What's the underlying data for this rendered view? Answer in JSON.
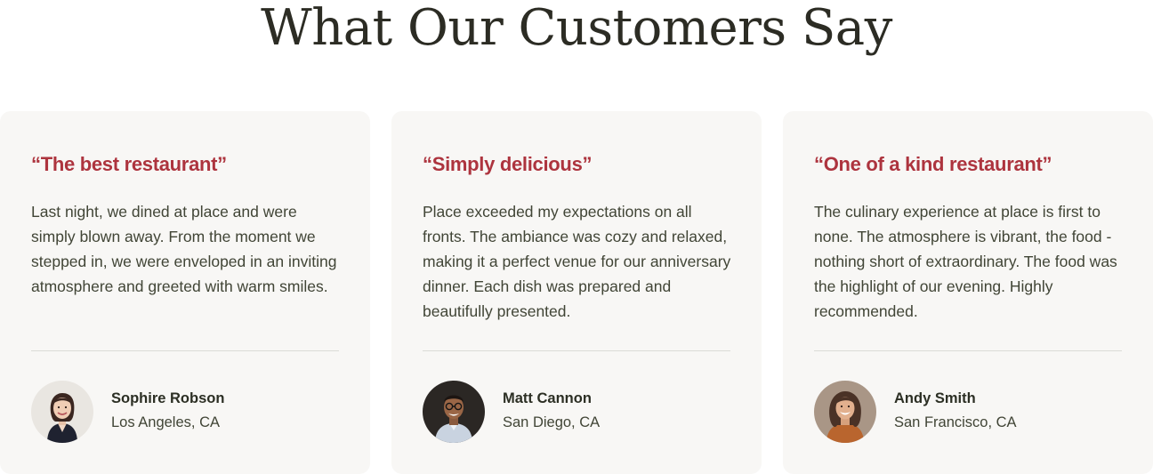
{
  "section": {
    "title": "What Our Customers Say"
  },
  "colors": {
    "accent": "#ad343e",
    "card_background": "#f8f7f5",
    "title": "#2c2c24",
    "body_text": "#414536"
  },
  "testimonials": [
    {
      "headline": "“The best restaurant”",
      "body": "Last night, we dined at place and were simply blown away. From the moment we stepped in, we were enveloped in an inviting atmosphere and greeted with warm smiles.",
      "name": "Sophire Robson",
      "location": "Los Angeles, CA",
      "avatar": "woman-portrait-avatar"
    },
    {
      "headline": "“Simply delicious”",
      "body": "Place exceeded my expectations on all fronts. The ambiance was cozy and relaxed, making it a perfect venue for our anniversary dinner. Each dish was prepared and beautifully presented.",
      "name": "Matt Cannon",
      "location": "San Diego, CA",
      "avatar": "man-glasses-portrait-avatar"
    },
    {
      "headline": "“One of a kind restaurant”",
      "body": "The culinary experience at place is first to none. The atmosphere is vibrant, the food - nothing short of extraordinary. The food was the highlight of our evening. Highly recommended.",
      "name": "Andy Smith",
      "location": "San Francisco, CA",
      "avatar": "woman-smiling-portrait-avatar"
    }
  ]
}
